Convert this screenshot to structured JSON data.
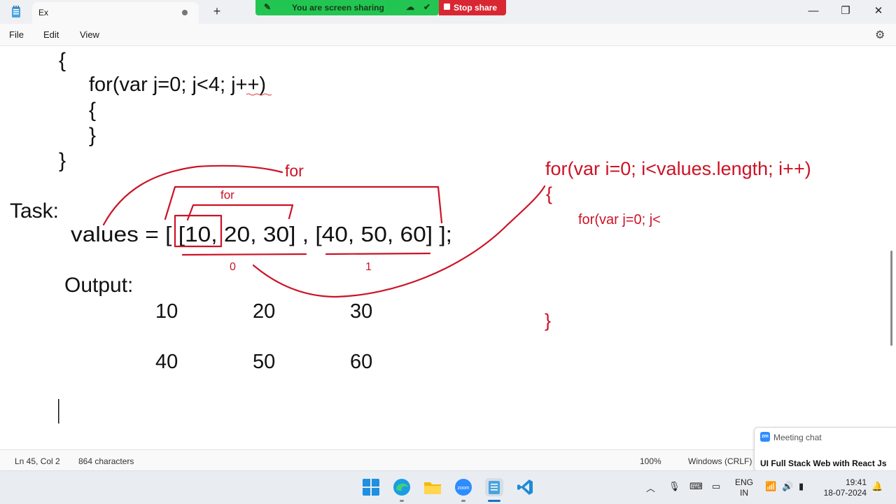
{
  "titlebar": {
    "tab_title": "Ex",
    "new_tab": "+",
    "minimize": "—",
    "maximize": "❐",
    "close": "✕"
  },
  "screen_share": {
    "status": "You are screen sharing",
    "stop_label": "Stop share",
    "bar_color": "#23c552",
    "stop_color": "#d92633"
  },
  "menu": {
    "file": "File",
    "edit": "Edit",
    "view": "View"
  },
  "editor": {
    "lines": {
      "open_brace_1": "{",
      "for_j_loop": "for(var j=0; j<4; j++)",
      "open_brace_2": "{",
      "close_brace_2": "}",
      "close_brace_1": "}",
      "task": "Task:",
      "values": "values = [ [10, 20, 30] , [40, 50, 60] ];",
      "output": "Output:"
    },
    "output_rows": [
      [
        "10",
        "20",
        "30"
      ],
      [
        "40",
        "50",
        "60"
      ]
    ]
  },
  "annotations": {
    "for_outer": "for",
    "for_inner": "for",
    "index_0": "0",
    "index_1": "1",
    "for_i_loop": "for(var i=0; i<values.length; i++)",
    "open_brace": "{",
    "for_j_partial": "for(var j=0; j<",
    "close_brace": "}",
    "ink_color": "#cc1326"
  },
  "status": {
    "position": "Ln 45, Col 2",
    "characters": "864 characters",
    "zoom": "100%",
    "line_ending": "Windows (CRLF)"
  },
  "meeting_chat": {
    "logo": "zm",
    "title": "Meeting chat",
    "message": "UI Full Stack Web with React Js"
  },
  "taskbar": {
    "zoom_label": "zoom",
    "lang_top": "ENG",
    "lang_bottom": "IN",
    "time": "19:41",
    "date": "18-07-2024"
  }
}
